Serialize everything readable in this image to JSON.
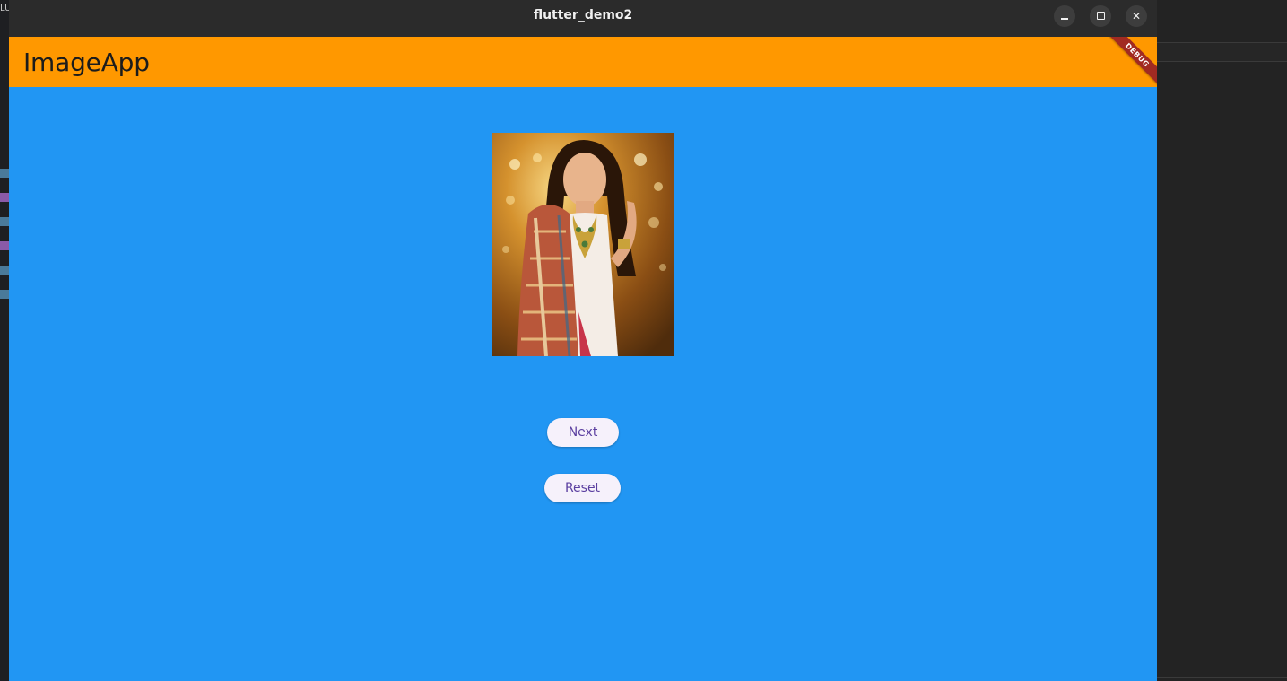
{
  "window": {
    "title": "flutter_demo2",
    "controls": {
      "minimize": "minimize-icon",
      "maximize": "maximize-icon",
      "close": "close-icon",
      "close_glyph": "✕"
    }
  },
  "appbar": {
    "title": "ImageApp",
    "color": "#ff9800",
    "debug_banner": "DEBUG"
  },
  "body": {
    "background": "#2196f3",
    "image": "portrait-photo",
    "buttons": {
      "next": "Next",
      "reset": "Reset"
    }
  },
  "background_left": {
    "label": "LU"
  }
}
